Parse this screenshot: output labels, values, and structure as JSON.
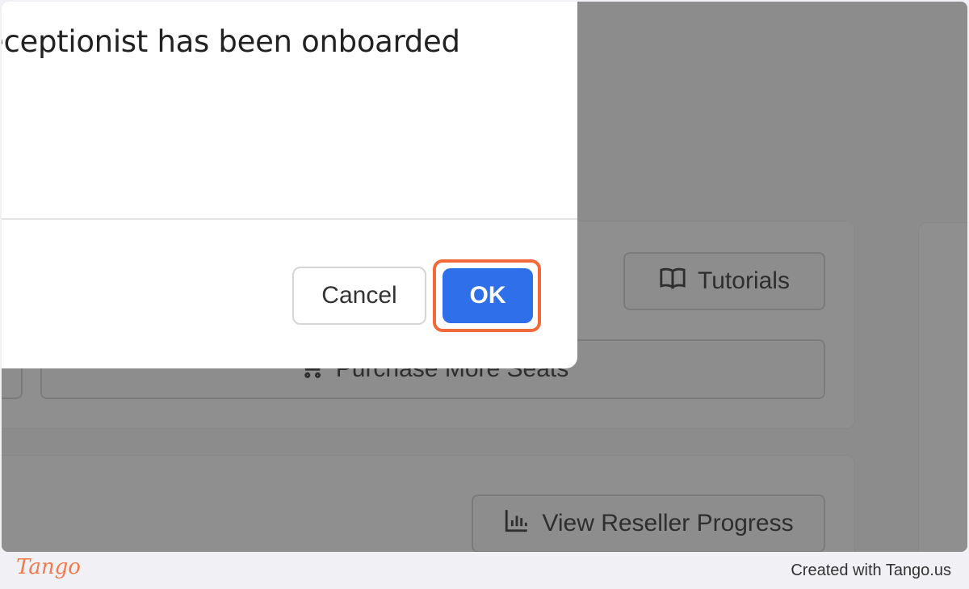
{
  "modal": {
    "title": "eceptionist has been onboarded",
    "cancel_label": "Cancel",
    "ok_label": "OK"
  },
  "background": {
    "tutorials_label": "Tutorials",
    "tutorials_icon": "book-icon",
    "purchase_label": "Purchase More Seats",
    "purchase_icon": "cart-icon",
    "reseller_label": "View Reseller Progress",
    "reseller_icon": "bar-chart-icon"
  },
  "footer": {
    "logo": "Tango",
    "created_text": "Created with Tango.us"
  },
  "colors": {
    "highlight": "#f26a3c",
    "ok_button": "#2f6fea",
    "overlay": "#8c8c8c",
    "brand": "#f07a4b"
  }
}
